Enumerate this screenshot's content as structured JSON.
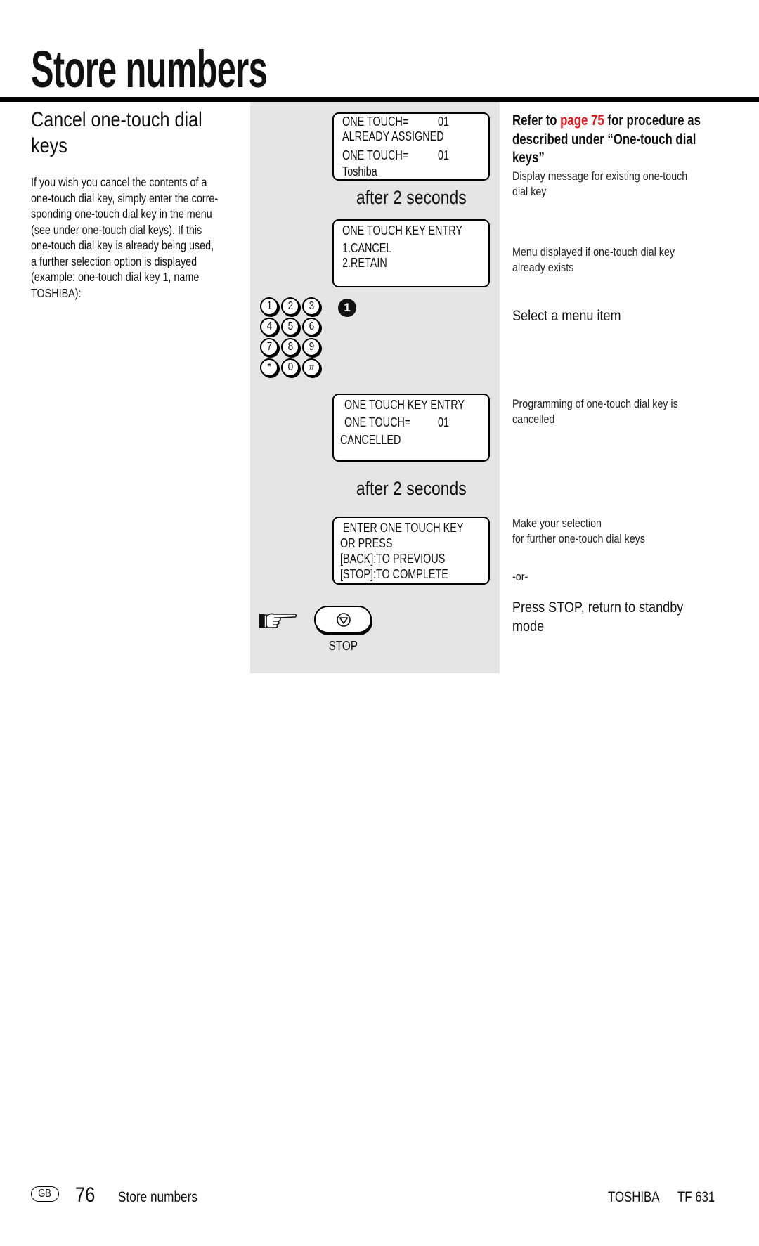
{
  "header": {
    "title": "Store numbers"
  },
  "section": {
    "title_lines": [
      "Cancel one-touch dial",
      "keys"
    ],
    "intro_lines": [
      "If you wish you cancel the contents of a",
      "one-touch dial key, simply enter the corre-",
      "sponding one-touch dial key in the menu",
      "(see under one-touch dial keys). If this",
      "one-touch dial key is already being used,",
      "a further selection option is displayed",
      "(example: one-touch dial key 1, name",
      "TOSHIBA):"
    ]
  },
  "steps": {
    "display_1": {
      "line1": "ONE TOUCH=",
      "line1_value": "01",
      "line2": "ALREADY ASSIGNED",
      "line3": "ONE TOUCH=",
      "line3_value": "01",
      "line4": "Toshiba"
    },
    "delay_1": "after 2 seconds",
    "display_2": {
      "line1": "ONE TOUCH KEY ENTRY",
      "line2": "1.CANCEL",
      "line3": "2.RETAIN"
    },
    "keypad": {
      "keys": [
        "1",
        "2",
        "3",
        "4",
        "5",
        "6",
        "7",
        "8",
        "9",
        "*",
        "0",
        "#"
      ],
      "selected_key": "1"
    },
    "display_3": {
      "line1": "ONE TOUCH KEY ENTRY",
      "line2": "ONE TOUCH=",
      "line2_value": "01",
      "line3": "CANCELLED"
    },
    "delay_2": "after 2 seconds",
    "display_4": {
      "line1": "ENTER ONE TOUCH KEY",
      "line2": "OR PRESS",
      "line3": "[BACK]:TO PREVIOUS",
      "line4": "[STOP]:TO COMPLETE"
    },
    "stop_button_label": "STOP"
  },
  "notes": {
    "ref": {
      "prefix": "Refer to ",
      "link": "page 75",
      "suffix_line1": " for procedure as",
      "line2": "described under “One-touch dial",
      "line3": "keys”",
      "link_color": "#e8141b"
    },
    "display_existing": [
      "Display message for existing one-touch",
      "dial key"
    ],
    "menu_exists": [
      "Menu displayed if one-touch dial key",
      "already exists"
    ],
    "select_menu": "Select a menu item",
    "cancelled": [
      "Programming of one-touch dial key is",
      "cancelled"
    ],
    "make_selection": [
      "Make your selection",
      "for further one-touch dial keys"
    ],
    "or": "-or-",
    "press_stop": [
      "Press STOP, return to standby",
      "mode"
    ]
  },
  "footer": {
    "language": "GB",
    "page_number": "76",
    "section": "Store numbers",
    "brand": "TOSHIBA",
    "model": "TF 631"
  }
}
